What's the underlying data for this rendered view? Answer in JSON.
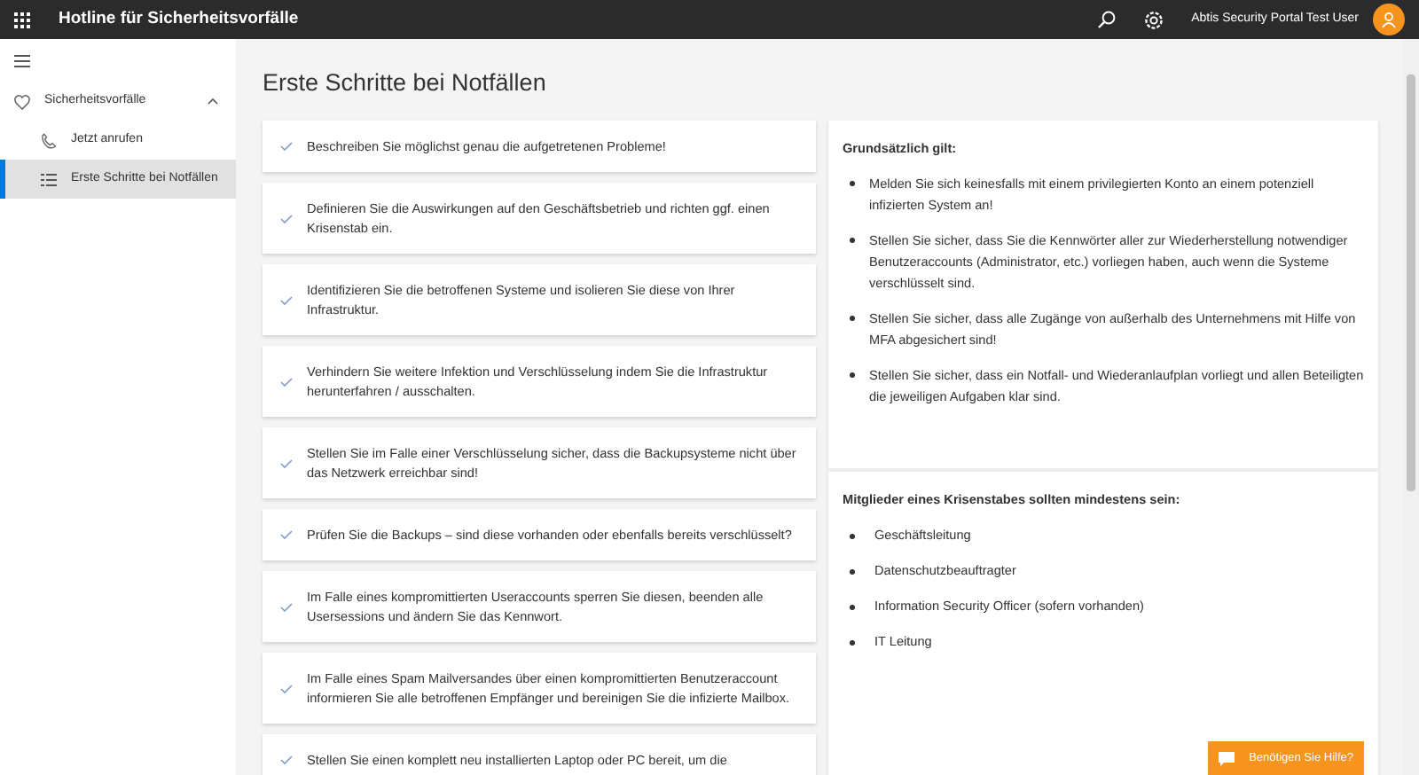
{
  "app_bar": {
    "title": "Hotline für Sicherheitsvorfälle",
    "user_name": "Abtis Security Portal Test User"
  },
  "sidebar": {
    "groups": [
      {
        "label": "Sicherheitsvorfälle",
        "expanded": true,
        "children": [
          {
            "label": "Jetzt anrufen",
            "kind": "phone",
            "selected": false
          },
          {
            "label": "Erste Schritte bei Notfällen",
            "kind": "list",
            "selected": true
          }
        ]
      }
    ]
  },
  "page_title": "Erste Schritte bei Notfällen",
  "steps": [
    {
      "text": "Beschreiben Sie möglichst genau die aufgetretenen Probleme!"
    },
    {
      "text": "Definieren Sie die Auswirkungen auf den Geschäftsbetrieb und richten ggf. einen Krisenstab ein."
    },
    {
      "text": "Identifizieren Sie die betroffenen Systeme und isolieren Sie diese von Ihrer Infrastruktur."
    },
    {
      "text": "Verhindern Sie weitere Infektion und Verschlüsselung indem Sie die Infrastruktur herunterfahren / ausschalten."
    },
    {
      "text": "Stellen Sie im Falle einer Verschlüsselung sicher, dass die Backupsysteme nicht über das Netzwerk erreichbar sind!"
    },
    {
      "text": "Prüfen Sie die Backups – sind diese vorhanden oder ebenfalls bereits verschlüsselt?"
    },
    {
      "text": "Im Falle eines kompromittierten Useraccounts sperren Sie diesen, beenden alle Usersessions und ändern Sie das Kennwort."
    },
    {
      "text": "Im Falle eines Spam Mailversandes über einen kompromittierten Benutzeraccount informieren Sie alle betroffenen Empfänger und bereinigen Sie die infizierte Mailbox."
    },
    {
      "text": "Stellen Sie einen komplett neu installierten Laptop oder PC bereit, um die"
    }
  ],
  "info_panels": [
    {
      "heading": "Grundsätzlich gilt:",
      "items": [
        "Melden Sie sich keinesfalls mit einem privilegierten Konto an einem potenziell infizierten System an!",
        "Stellen Sie sicher, dass Sie die Kennwörter aller zur Wiederherstellung notwendiger Benutzeraccounts (Administrator, etc.) vorliegen haben, auch wenn die Systeme verschlüsselt sind.",
        "Stellen Sie sicher, dass alle Zugänge von außerhalb des Unternehmens mit Hilfe von MFA abgesichert sind!",
        "Stellen Sie sicher, dass ein Notfall- und Wiederanlaufplan vorliegt und allen Beteiligten die jeweiligen Aufgaben klar sind."
      ]
    },
    {
      "heading": "Mitglieder eines Krisenstabes sollten mindestens sein:",
      "items": [
        "Geschäftsleitung",
        "Datenschutzbeauftragter",
        "Information Security Officer (sofern vorhanden)",
        "IT Leitung"
      ]
    }
  ],
  "help_button": {
    "label": "Benötigen Sie Hilfe?"
  }
}
